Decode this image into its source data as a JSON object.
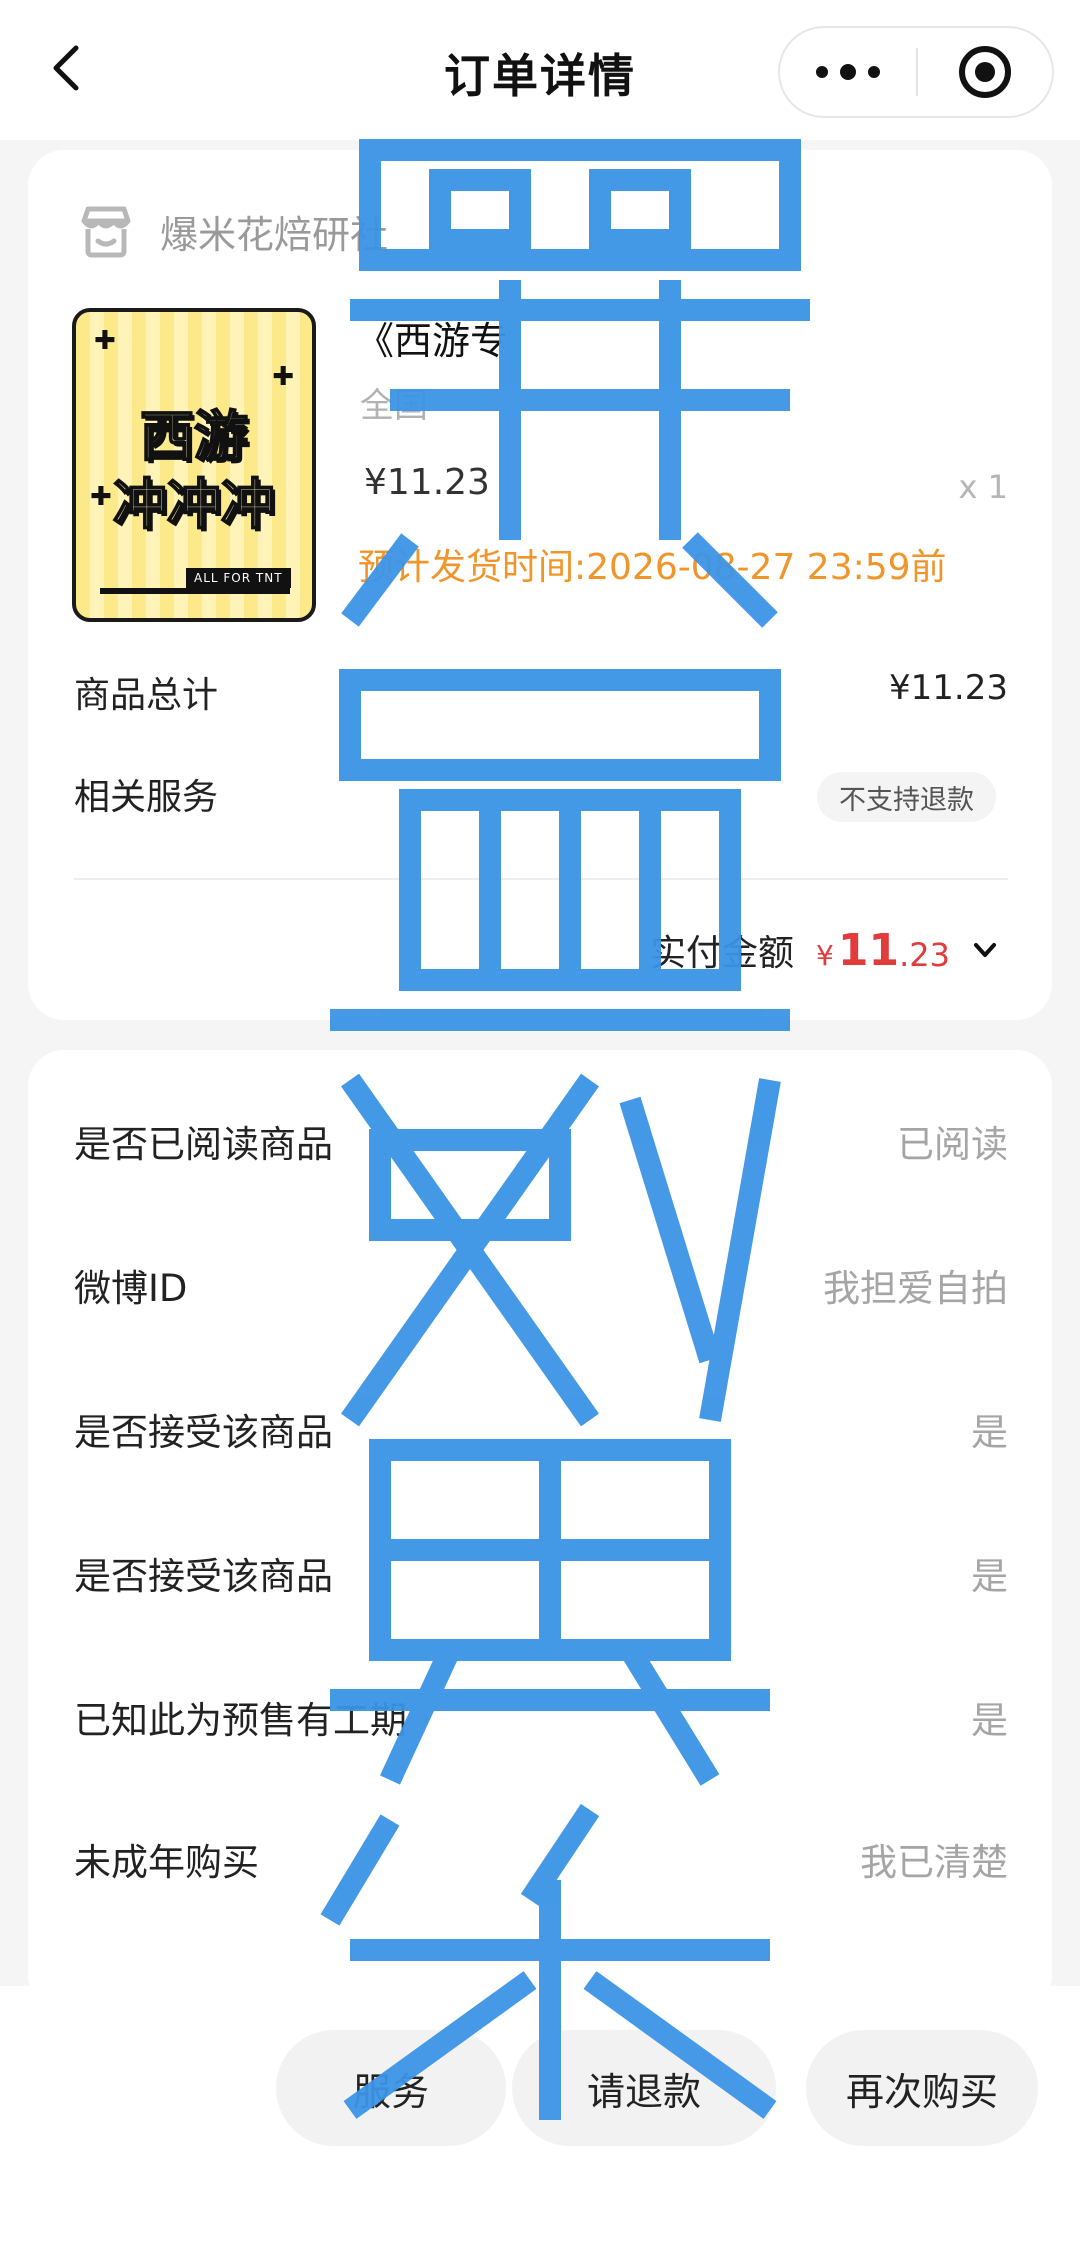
{
  "header": {
    "title": "订单详情",
    "back_icon": "chevron-left-icon",
    "more_icon": "more-dots-icon",
    "close_icon": "miniprogram-close-icon"
  },
  "shop": {
    "name": "爆米花焙研社",
    "icon": "shop-icon"
  },
  "product": {
    "image_text_line1": "西游",
    "image_text_line2": "冲冲冲",
    "image_tag": "ALL FOR TNT",
    "title": "《西游专",
    "spec": "全国",
    "price": "¥11.23",
    "quantity": "x 1",
    "ship_time": "预计发货时间:2026-08-27 23:59前"
  },
  "summary": {
    "total_label": "商品总计",
    "total_value": "¥11.23",
    "service_label": "相关服务",
    "service_badge": "不支持退款",
    "paid_label": "实付金额",
    "paid_symbol": "¥",
    "paid_int": "11",
    "paid_dec": ".23"
  },
  "info_rows": [
    {
      "label": "是否已阅读商品",
      "value": "已阅读"
    },
    {
      "label": "微博ID",
      "value": "我担爱自拍"
    },
    {
      "label": "是否接受该商品",
      "value": "是"
    },
    {
      "label": "是否接受该商品",
      "value": "是"
    },
    {
      "label": "已知此为预售有工期",
      "value": "是"
    },
    {
      "label": "未成年购买",
      "value": "我已清楚"
    }
  ],
  "actions": {
    "contact": "服务",
    "refund": "请退款",
    "rebuy": "再次购买"
  },
  "colors": {
    "accent_red": "#e23b3b",
    "ship_orange": "#f0952a",
    "watermark_blue": "#3b94e6"
  }
}
